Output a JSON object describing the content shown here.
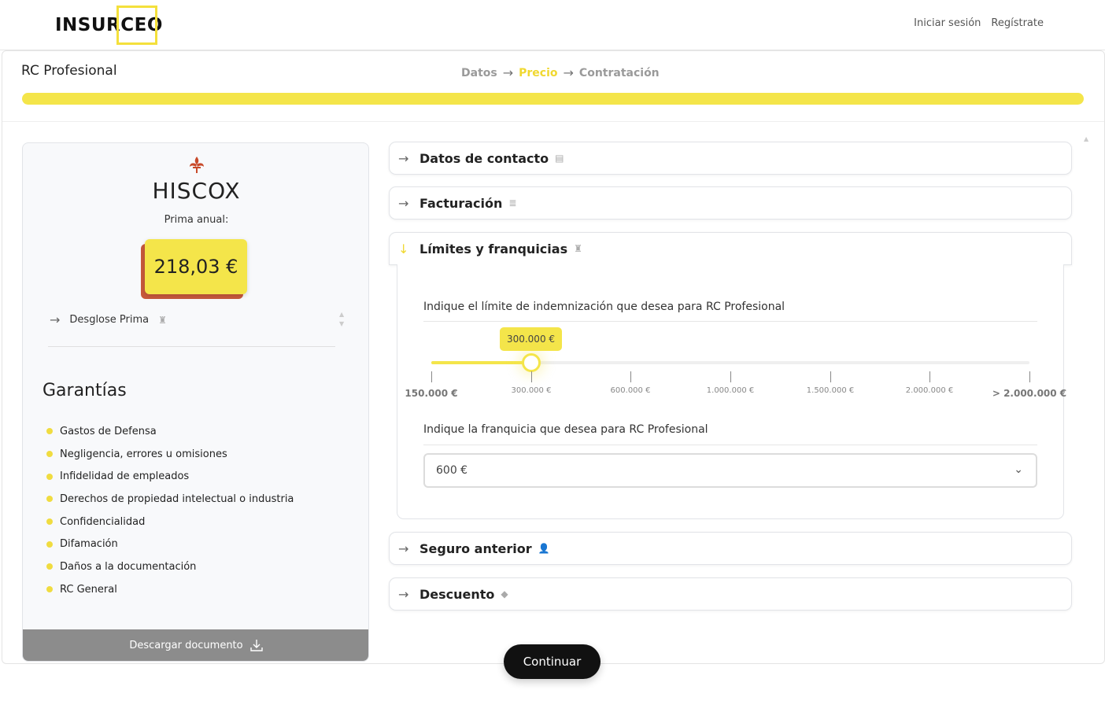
{
  "header": {
    "logo_text": "INSURCEO",
    "login_label": "Iniciar sesión",
    "register_label": "Regístrate"
  },
  "page": {
    "product_title": "RC Profesional",
    "steps": [
      "Datos",
      "Precio",
      "Contratación"
    ],
    "active_step": "Precio",
    "progress_fraction": 1.0
  },
  "quote": {
    "insurer_name": "HISCOX",
    "premium_label": "Prima anual:",
    "premium_value": "218,03 €",
    "breakdown_label": "Desglose Prima",
    "guarantees_title": "Garantías",
    "guarantees": [
      "Gastos de Defensa",
      "Negligencia, errores u omisiones",
      "Infidelidad de empleados",
      "Derechos de propiedad intelectual o industria",
      "Confidencialidad",
      "Difamación",
      "Daños a la documentación",
      "RC General"
    ],
    "download_label": "Descargar documento"
  },
  "accordion": {
    "contact_label": "Datos de contacto",
    "billing_label": "Facturación",
    "limits_label": "Límites y franquicias",
    "previous_label": "Seguro anterior",
    "discount_label": "Descuento"
  },
  "limits": {
    "limit_question": "Indique el límite de indemnización que desea para RC Profesional",
    "selected_limit": "300.000 €",
    "selected_index": 1,
    "tick_labels": [
      "150.000 €",
      "300.000 €",
      "600.000 €",
      "1.000.000 €",
      "1.500.000 €",
      "2.000.000 €",
      "> 2.000.000 €"
    ],
    "deductible_question": "Indique la franquicia que desea para RC Profesional",
    "deductible_value": "600 €"
  },
  "actions": {
    "continue_label": "Continuar"
  },
  "colors": {
    "accent": "#f4e54a",
    "price_shadow": "#c85a3c",
    "dark_button": "#111111"
  }
}
